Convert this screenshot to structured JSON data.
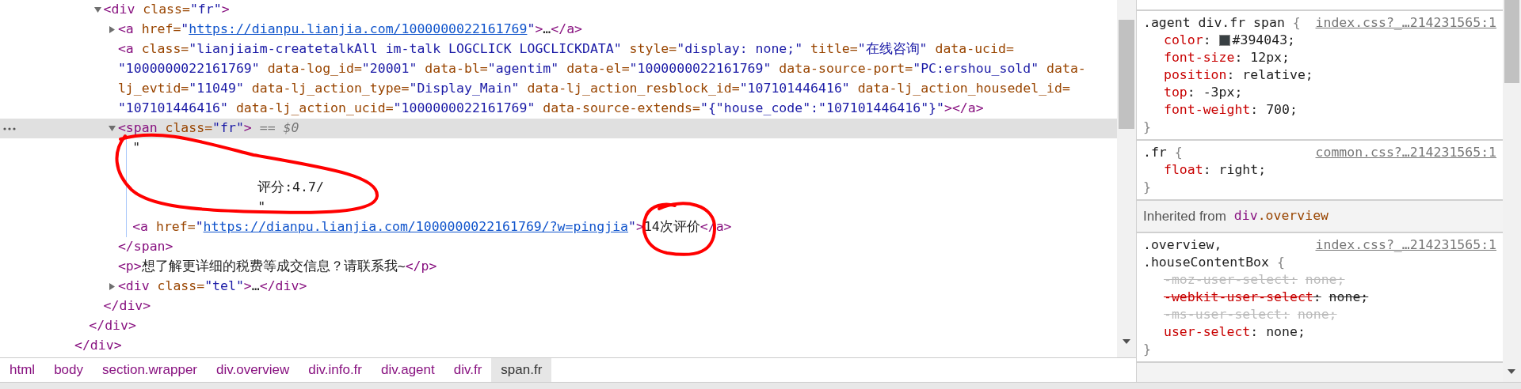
{
  "dom_tree": [
    {
      "close": [
        {
          "kind": "tag",
          "text": "</div>"
        }
      ],
      "children": [
        {
          "close": [
            {
              "kind": "tag",
              "text": "</div>"
            }
          ],
          "children": [
            {
              "expanded": true,
              "selected": false,
              "lines": [
                [
                  {
                    "kind": "tag",
                    "text": "<div"
                  },
                  {
                    "kind": "an",
                    "text": "class="
                  },
                  {
                    "kind": "av",
                    "text": "\"fr\""
                  },
                  {
                    "kind": "tag",
                    "text": ">"
                  }
                ]
              ],
              "close": [
                {
                  "kind": "tag",
                  "text": "</div>"
                }
              ],
              "children": [
                {
                  "expanded": false,
                  "selected": false,
                  "lines": [
                    [
                      {
                        "kind": "tag",
                        "text": "<a"
                      },
                      {
                        "kind": "an",
                        "text": "href="
                      },
                      {
                        "kind": "av",
                        "text": "\""
                      },
                      {
                        "kind": "link",
                        "text": "https://dianpu.lianjia.com/1000000022161769"
                      },
                      {
                        "kind": "av",
                        "text": "\""
                      },
                      {
                        "kind": "tag",
                        "text": ">"
                      },
                      {
                        "kind": "tx",
                        "text": "…"
                      },
                      {
                        "kind": "tag",
                        "text": "</a>"
                      }
                    ]
                  ]
                },
                {
                  "selected": false,
                  "lines": [
                    [
                      {
                        "kind": "tag",
                        "text": "<a"
                      },
                      {
                        "kind": "an",
                        "text": "class="
                      },
                      {
                        "kind": "av",
                        "text": "\"lianjiaim-createtalkAll im-talk LOGCLICK LOGCLICKDATA\""
                      },
                      {
                        "kind": "an",
                        "text": "style="
                      },
                      {
                        "kind": "av",
                        "text": "\"display: none;\""
                      },
                      {
                        "kind": "an",
                        "text": "title="
                      },
                      {
                        "kind": "av",
                        "text": "\"在线咨询\""
                      },
                      {
                        "kind": "an",
                        "text": "data-ucid="
                      }
                    ],
                    [
                      {
                        "kind": "av",
                        "text": "\"1000000022161769\""
                      },
                      {
                        "kind": "an",
                        "text": "data-log_id="
                      },
                      {
                        "kind": "av",
                        "text": "\"20001\""
                      },
                      {
                        "kind": "an",
                        "text": "data-bl="
                      },
                      {
                        "kind": "av",
                        "text": "\"agentim\""
                      },
                      {
                        "kind": "an",
                        "text": "data-el="
                      },
                      {
                        "kind": "av",
                        "text": "\"1000000022161769\""
                      },
                      {
                        "kind": "an",
                        "text": "data-source-port="
                      },
                      {
                        "kind": "av",
                        "text": "\"PC:ershou_sold\""
                      },
                      {
                        "kind": "an",
                        "text": "data-"
                      }
                    ],
                    [
                      {
                        "kind": "an",
                        "text": "lj_evtid="
                      },
                      {
                        "kind": "av",
                        "text": "\"11049\""
                      },
                      {
                        "kind": "an",
                        "text": "data-lj_action_type="
                      },
                      {
                        "kind": "av",
                        "text": "\"Display_Main\""
                      },
                      {
                        "kind": "an",
                        "text": "data-lj_action_resblock_id="
                      },
                      {
                        "kind": "av",
                        "text": "\"107101446416\""
                      },
                      {
                        "kind": "an",
                        "text": "data-lj_action_housedel_id="
                      }
                    ],
                    [
                      {
                        "kind": "av",
                        "text": "\"107101446416\""
                      },
                      {
                        "kind": "an",
                        "text": "data-lj_action_ucid="
                      },
                      {
                        "kind": "av",
                        "text": "\"1000000022161769\""
                      },
                      {
                        "kind": "an",
                        "text": "data-source-extends="
                      },
                      {
                        "kind": "av",
                        "text": "\"{\"house_code\":\"107101446416\"}\""
                      },
                      {
                        "kind": "tag",
                        "text": "></a>"
                      }
                    ]
                  ]
                },
                {
                  "expanded": true,
                  "selected": true,
                  "lines": [
                    [
                      {
                        "kind": "tag",
                        "text": "<span"
                      },
                      {
                        "kind": "an",
                        "text": "class="
                      },
                      {
                        "kind": "av",
                        "text": "\"fr\""
                      },
                      {
                        "kind": "tag",
                        "text": ">"
                      },
                      {
                        "kind": "hint",
                        "text": "== $0"
                      }
                    ]
                  ],
                  "close": [
                    {
                      "kind": "tag",
                      "text": "</span>"
                    }
                  ],
                  "children": [
                    {
                      "kind": "text",
                      "lines": [
                        "\"",
                        "评分:4.7/",
                        "\""
                      ]
                    },
                    {
                      "selected": false,
                      "lines": [
                        [
                          {
                            "kind": "tag",
                            "text": "<a"
                          },
                          {
                            "kind": "an",
                            "text": "href="
                          },
                          {
                            "kind": "av",
                            "text": "\""
                          },
                          {
                            "kind": "link",
                            "text": "https://dianpu.lianjia.com/1000000022161769/?w=pingjia"
                          },
                          {
                            "kind": "av",
                            "text": "\""
                          },
                          {
                            "kind": "tag",
                            "text": ">"
                          },
                          {
                            "kind": "tx",
                            "text": "14次评价"
                          },
                          {
                            "kind": "tag",
                            "text": "</a>"
                          }
                        ]
                      ]
                    }
                  ]
                },
                {
                  "selected": false,
                  "lines": [
                    [
                      {
                        "kind": "tag",
                        "text": "<p>"
                      },
                      {
                        "kind": "tx",
                        "text": "想了解更详细的税费等成交信息？请联系我~"
                      },
                      {
                        "kind": "tag",
                        "text": "</p>"
                      }
                    ]
                  ]
                },
                {
                  "expanded": false,
                  "selected": false,
                  "lines": [
                    [
                      {
                        "kind": "tag",
                        "text": "<div"
                      },
                      {
                        "kind": "an",
                        "text": "class="
                      },
                      {
                        "kind": "av",
                        "text": "\"tel\""
                      },
                      {
                        "kind": "tag",
                        "text": ">"
                      },
                      {
                        "kind": "tx",
                        "text": "…"
                      },
                      {
                        "kind": "tag",
                        "text": "</div>"
                      }
                    ]
                  ]
                }
              ]
            }
          ]
        }
      ]
    }
  ],
  "breadcrumb": [
    {
      "label": "html",
      "selected": false
    },
    {
      "label": "body",
      "selected": false
    },
    {
      "label": "section.wrapper",
      "selected": false
    },
    {
      "label": "div.overview",
      "selected": false
    },
    {
      "label": "div.info.fr",
      "selected": false
    },
    {
      "label": "div.agent",
      "selected": false
    },
    {
      "label": "div.fr",
      "selected": false
    },
    {
      "label": "span.fr",
      "selected": true
    }
  ],
  "styles": [
    {
      "kind": "fragment"
    },
    {
      "kind": "rule",
      "selectors": [
        ".agent div.fr span"
      ],
      "brace": "{",
      "source": "index.css?_…214231565:1",
      "close": "}",
      "properties": [
        {
          "name": "color",
          "colon": ":",
          "value": "#394043;",
          "color": "#394043",
          "overridden": false,
          "invalid": false
        },
        {
          "name": "font-size",
          "colon": ":",
          "value": "12px;",
          "overridden": false,
          "invalid": false
        },
        {
          "name": "position",
          "colon": ":",
          "value": "relative;",
          "overridden": false,
          "invalid": false
        },
        {
          "name": "top",
          "colon": ":",
          "value": "-3px;",
          "overridden": false,
          "invalid": false
        },
        {
          "name": "font-weight",
          "colon": ":",
          "value": "700;",
          "overridden": false,
          "invalid": false
        }
      ]
    },
    {
      "kind": "rule",
      "selectors": [
        ".fr"
      ],
      "brace": "{",
      "source": "common.css?…214231565:1",
      "close": "}",
      "properties": [
        {
          "name": "float",
          "colon": ":",
          "value": "right;",
          "overridden": false,
          "invalid": false
        }
      ]
    },
    {
      "kind": "inherited",
      "label": "Inherited from",
      "tag": "div",
      "class": ".overview"
    },
    {
      "kind": "rule",
      "selectors": [
        ".overview,",
        ".houseContentBox"
      ],
      "brace": "{",
      "source": "index.css?_…214231565:1",
      "close": "}",
      "properties": [
        {
          "name": "-moz-user-select",
          "colon": ":",
          "value": "none;",
          "invalid": true
        },
        {
          "name": "-webkit-user-select",
          "colon": ":",
          "value": "none;",
          "overridden": true,
          "invalid": false
        },
        {
          "name": "-ms-user-select",
          "colon": ":",
          "value": "none;",
          "invalid": true
        },
        {
          "name": "user-select",
          "colon": ":",
          "value": "none;",
          "overridden": false,
          "invalid": false
        }
      ]
    }
  ]
}
